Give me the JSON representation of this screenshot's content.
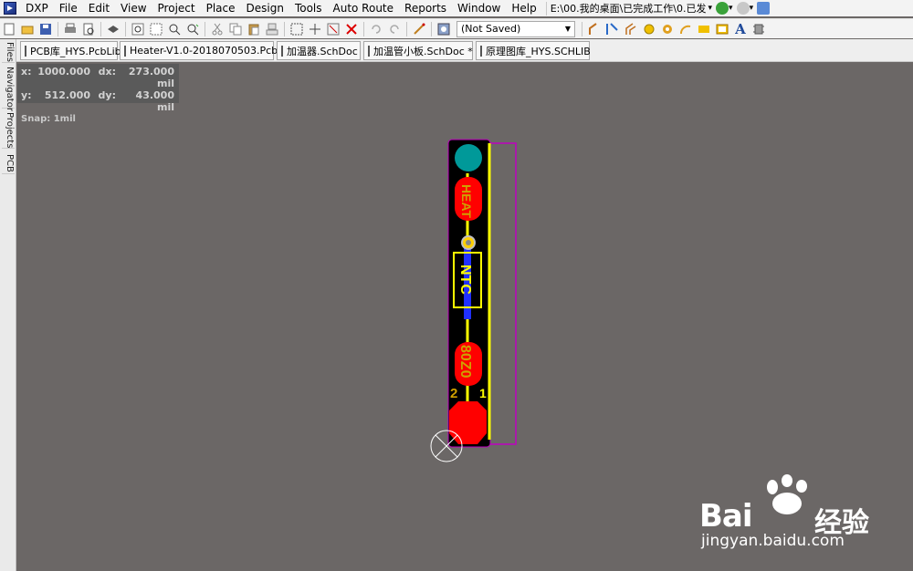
{
  "app": {
    "name": "DXP"
  },
  "menu": [
    "DXP",
    "File",
    "Edit",
    "View",
    "Project",
    "Place",
    "Design",
    "Tools",
    "Auto Route",
    "Reports",
    "Window",
    "Help"
  ],
  "path": "E:\\00.我的桌面\\已完成工作\\0.已发",
  "toolbar": {
    "combo_value": "(Not Saved)"
  },
  "tabs": [
    {
      "label": "PCB库_HYS.PcbLib",
      "icon": "pcblib-icon"
    },
    {
      "label": "Heater-V1.0-2018070503.PcbDoc",
      "icon": "pcbdoc-icon"
    },
    {
      "label": "加温器.SchDoc",
      "icon": "schdoc-icon"
    },
    {
      "label": "加温管小板.SchDoc *",
      "icon": "schdoc-icon"
    },
    {
      "label": "原理图库_HYS.SCHLIB",
      "icon": "schlib-icon"
    }
  ],
  "side_tabs": [
    "Files",
    "Navigator",
    "Projects",
    "PCB"
  ],
  "coords": {
    "x_label": "x:",
    "x": "1000.000",
    "dx_label": "dx:",
    "dx": "273.000 mil",
    "y_label": "y:",
    "y": "512.000",
    "dy_label": "dy:",
    "dy": "43.000 mil",
    "snap": "Snap: 1mil"
  },
  "pcb": {
    "silk_heater": "HEAT",
    "silk_ntc": "NTC",
    "silk_part": "80Z0",
    "silk_2": "2",
    "silk_1": "1",
    "colors": {
      "board": "#000000",
      "pad_red": "#ff0000",
      "pad_teal": "#009999",
      "trace_blue": "#2030ff",
      "silk_yellow": "#ffff00",
      "outline_magenta": "#c000c0"
    }
  },
  "watermark": {
    "brand": "Bai",
    "brand_cn": "经验",
    "url": "jingyan.baidu.com"
  }
}
